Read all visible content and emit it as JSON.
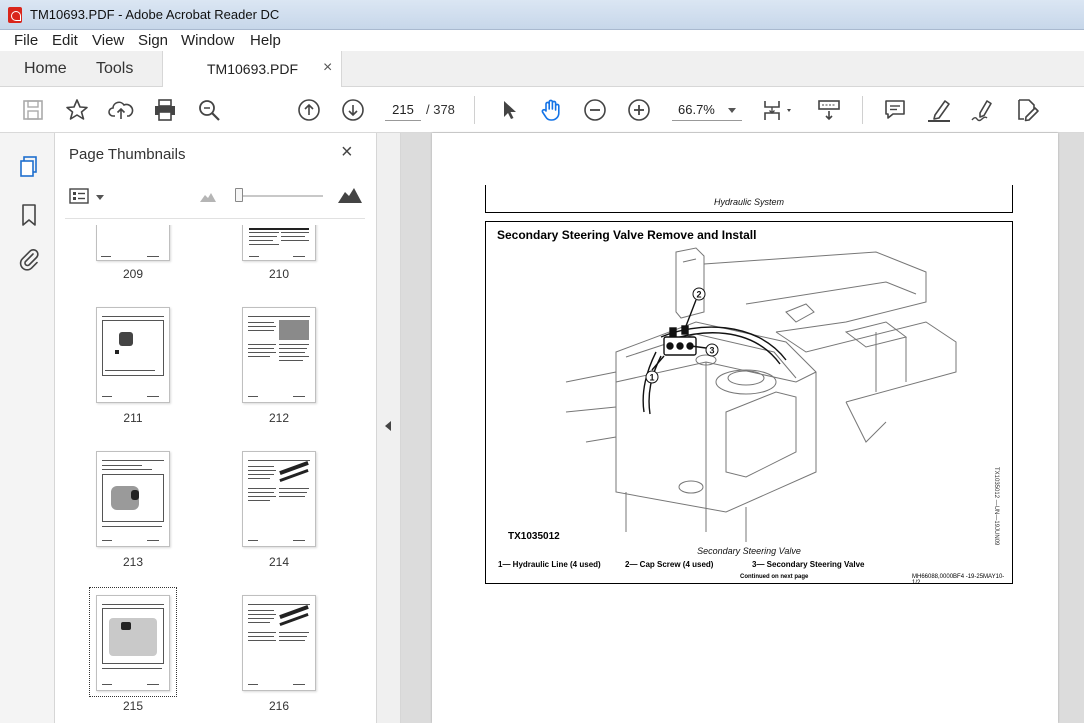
{
  "window": {
    "title": "TM10693.PDF - Adobe Acrobat Reader DC"
  },
  "menu": {
    "items": [
      "File",
      "Edit",
      "View",
      "Sign",
      "Window",
      "Help"
    ]
  },
  "tabs": {
    "home": "Home",
    "tools": "Tools",
    "document": "TM10693.PDF",
    "close": "×"
  },
  "toolbar": {
    "current_page": "215",
    "total_pages": "/ 378",
    "zoom": "66.7%"
  },
  "thumbnails": {
    "title": "Page Thumbnails",
    "close": "×",
    "pages": [
      {
        "label": "209"
      },
      {
        "label": "210"
      },
      {
        "label": "211"
      },
      {
        "label": "212"
      },
      {
        "label": "213"
      },
      {
        "label": "214"
      },
      {
        "label": "215"
      },
      {
        "label": "216"
      }
    ],
    "selected": "215"
  },
  "document": {
    "header": "Hydraulic System",
    "figure_title": "Secondary Steering Valve Remove and Install",
    "figure_id": "TX1035012",
    "caption": "Secondary Steering Valve",
    "callouts": [
      "1",
      "2",
      "3"
    ],
    "legend": [
      "1— Hydraulic Line (4 used)",
      "2— Cap Screw (4 used)",
      "3— Secondary Steering Valve"
    ],
    "continued": "Continued on next page",
    "code": "MH66088,0000BF4 -19-25MAY10-1/2",
    "side_text": "TX1035012 —UN—19JUN09"
  },
  "colors": {
    "pdf_red": "#d9261c",
    "accent_blue": "#1f6fcf",
    "hand_blue": "#1473e6"
  }
}
